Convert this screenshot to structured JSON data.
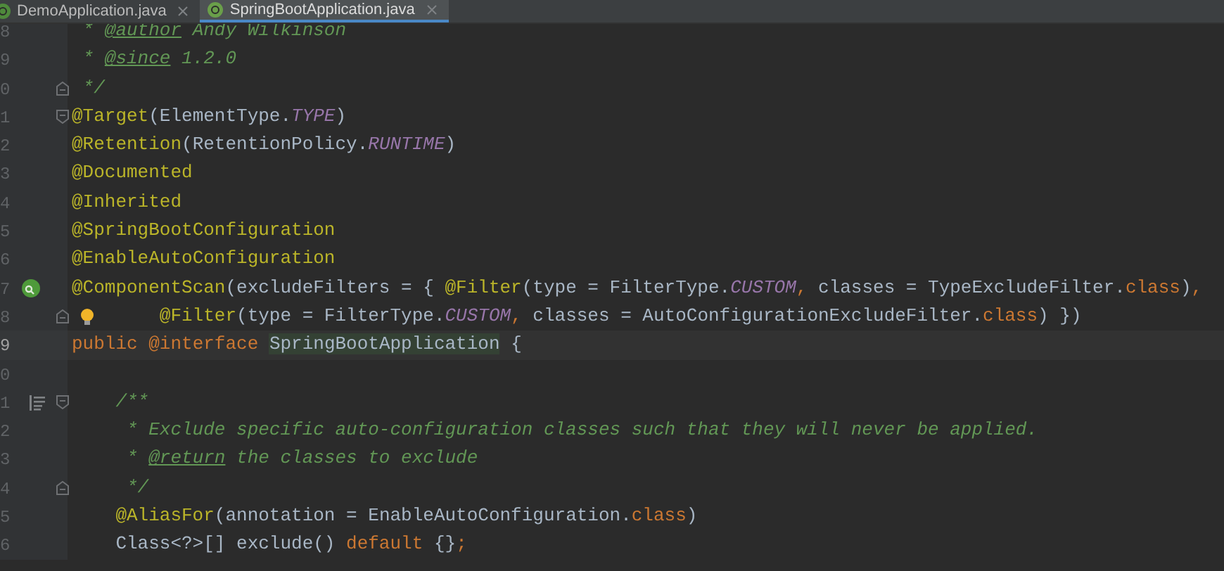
{
  "tabs": [
    {
      "label": "DemoApplication.java",
      "selected": false
    },
    {
      "label": "SpringBootApplication.java",
      "selected": true
    }
  ],
  "lines": [
    {
      "number": "8",
      "current": false,
      "tokens": [
        {
          "text": " * ",
          "kind": "comment"
        },
        {
          "text": "@author",
          "kind": "doctag"
        },
        {
          "text": " Andy Wilkinson",
          "kind": "comment"
        }
      ]
    },
    {
      "number": "9",
      "current": false,
      "tokens": [
        {
          "text": " * ",
          "kind": "comment"
        },
        {
          "text": "@since",
          "kind": "doctag"
        },
        {
          "text": " 1.2.0",
          "kind": "comment"
        }
      ]
    },
    {
      "number": "0",
      "current": false,
      "fold_end": true,
      "tokens": [
        {
          "text": " */",
          "kind": "comment"
        }
      ]
    },
    {
      "number": "1",
      "current": false,
      "fold_start": true,
      "tokens": [
        {
          "text": "@Target",
          "kind": "annotation"
        },
        {
          "text": "(ElementType.",
          "kind": "plain"
        },
        {
          "text": "TYPE",
          "kind": "constant"
        },
        {
          "text": ")",
          "kind": "plain"
        }
      ]
    },
    {
      "number": "2",
      "current": false,
      "tokens": [
        {
          "text": "@Retention",
          "kind": "annotation"
        },
        {
          "text": "(RetentionPolicy.",
          "kind": "plain"
        },
        {
          "text": "RUNTIME",
          "kind": "constant"
        },
        {
          "text": ")",
          "kind": "plain"
        }
      ]
    },
    {
      "number": "3",
      "current": false,
      "tokens": [
        {
          "text": "@Documented",
          "kind": "annotation"
        }
      ]
    },
    {
      "number": "4",
      "current": false,
      "tokens": [
        {
          "text": "@Inherited",
          "kind": "annotation"
        }
      ]
    },
    {
      "number": "5",
      "current": false,
      "tokens": [
        {
          "text": "@SpringBootConfiguration",
          "kind": "annotation"
        }
      ]
    },
    {
      "number": "6",
      "current": false,
      "tokens": [
        {
          "text": "@EnableAutoConfiguration",
          "kind": "annotation"
        }
      ]
    },
    {
      "number": "7",
      "current": false,
      "bean": true,
      "tokens": [
        {
          "text": "@ComponentScan",
          "kind": "annotation"
        },
        {
          "text": "(excludeFilters = { ",
          "kind": "plain"
        },
        {
          "text": "@Filter",
          "kind": "annotation"
        },
        {
          "text": "(type = FilterType.",
          "kind": "plain"
        },
        {
          "text": "CUSTOM",
          "kind": "constant"
        },
        {
          "text": ", ",
          "kind": "keyword"
        },
        {
          "text": "classes = TypeExcludeFilter.",
          "kind": "plain"
        },
        {
          "text": "class",
          "kind": "keyword"
        },
        {
          "text": ")",
          "kind": "plain"
        },
        {
          "text": ",",
          "kind": "keyword"
        }
      ]
    },
    {
      "number": "8",
      "current": false,
      "fold_end": true,
      "bulb": true,
      "tokens": [
        {
          "text": "        @Filter",
          "kind": "annotation"
        },
        {
          "text": "(type = FilterType.",
          "kind": "plain"
        },
        {
          "text": "CUSTOM",
          "kind": "constant"
        },
        {
          "text": ", ",
          "kind": "keyword"
        },
        {
          "text": "classes = AutoConfigurationExcludeFilter.",
          "kind": "plain"
        },
        {
          "text": "class",
          "kind": "keyword"
        },
        {
          "text": ") })",
          "kind": "plain"
        }
      ]
    },
    {
      "number": "9",
      "current": true,
      "tokens": [
        {
          "text": "public ",
          "kind": "keyword"
        },
        {
          "text": "@interface ",
          "kind": "keyword"
        },
        {
          "text": "SpringBootApplication",
          "kind": "highlight"
        },
        {
          "text": " {",
          "kind": "plain"
        }
      ]
    },
    {
      "number": "0",
      "current": false
    },
    {
      "number": "1",
      "current": false,
      "doc": true,
      "fold_start": true,
      "tokens": [
        {
          "text": "    /**",
          "kind": "comment"
        }
      ]
    },
    {
      "number": "2",
      "current": false,
      "tokens": [
        {
          "text": "     * Exclude specific auto-configuration classes such that they will never be applied.",
          "kind": "comment"
        }
      ]
    },
    {
      "number": "3",
      "current": false,
      "tokens": [
        {
          "text": "     * ",
          "kind": "comment"
        },
        {
          "text": "@return",
          "kind": "doctag"
        },
        {
          "text": " the classes to exclude",
          "kind": "comment"
        }
      ]
    },
    {
      "number": "4",
      "current": false,
      "fold_end": true,
      "tokens": [
        {
          "text": "     */",
          "kind": "comment"
        }
      ]
    },
    {
      "number": "5",
      "current": false,
      "tokens": [
        {
          "text": "    @AliasFor",
          "kind": "annotation"
        },
        {
          "text": "(annotation = EnableAutoConfiguration.",
          "kind": "plain"
        },
        {
          "text": "class",
          "kind": "keyword"
        },
        {
          "text": ")",
          "kind": "plain"
        }
      ]
    },
    {
      "number": "6",
      "current": false,
      "tokens": [
        {
          "text": "    Class<?>[] exclude() ",
          "kind": "plain"
        },
        {
          "text": "default ",
          "kind": "keyword"
        },
        {
          "text": "{}",
          "kind": "plain"
        },
        {
          "text": ";",
          "kind": "keyword"
        }
      ]
    }
  ]
}
